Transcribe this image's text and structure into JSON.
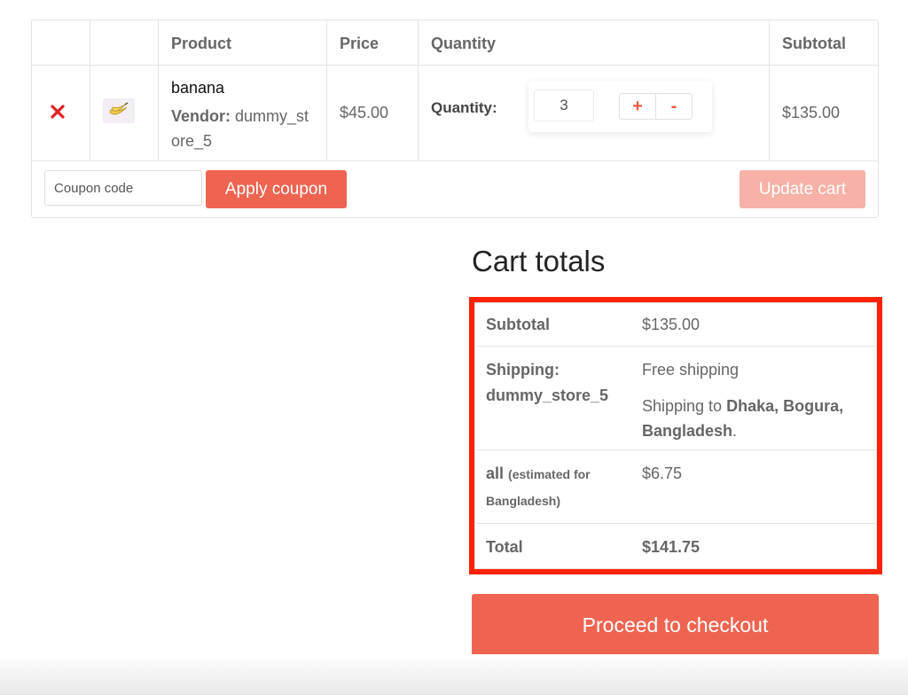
{
  "cart_table": {
    "headers": {
      "product": "Product",
      "price": "Price",
      "quantity": "Quantity",
      "subtotal": "Subtotal"
    },
    "item": {
      "thumbnail_icon": "banana-icon",
      "name": "banana",
      "vendor_label": "Vendor:",
      "vendor_name": "dummy_store_5",
      "price": "$45.00",
      "quantity_label": "Quantity:",
      "quantity_value": "3",
      "plus_label": "+",
      "minus_label": "-",
      "subtotal": "$135.00"
    },
    "coupon_placeholder": "Coupon code",
    "apply_coupon_label": "Apply coupon",
    "update_cart_label": "Update cart"
  },
  "cart_totals": {
    "title": "Cart totals",
    "subtotal_label": "Subtotal",
    "subtotal_value": "$135.00",
    "shipping_label_1": "Shipping:",
    "shipping_label_2": "dummy_store_5",
    "shipping_method": "Free shipping",
    "shipping_to_prefix": "Shipping to ",
    "shipping_to_place_1": "Dhaka, Bogura,",
    "shipping_to_place_2": "Bangladesh",
    "shipping_to_suffix": ".",
    "tax_label": "all",
    "tax_note_1": "(estimated for",
    "tax_note_2": "Bangladesh)",
    "tax_value": "$6.75",
    "total_label": "Total",
    "total_value": "$141.75",
    "checkout_label": "Proceed to checkout"
  },
  "colors": {
    "accent": "#ef6451",
    "highlight_border": "#ff2200",
    "remove": "#e02020"
  }
}
